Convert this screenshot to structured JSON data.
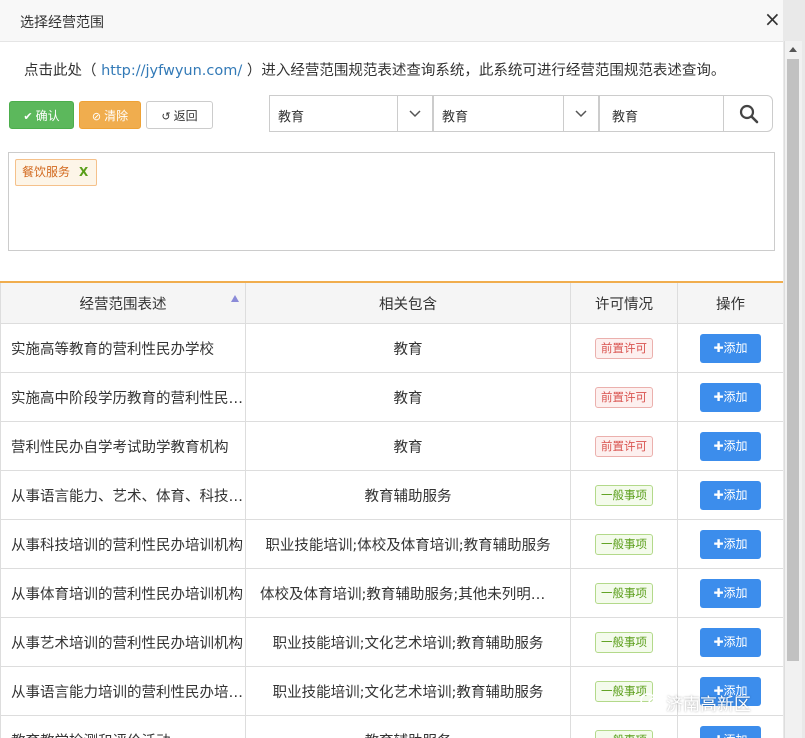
{
  "dialog": {
    "title": "选择经营范围",
    "close": "×"
  },
  "info": {
    "prefix": "点击此处（ ",
    "link": "http://jyfwyun.com/",
    "suffix": " ）进入经营范围规范表述查询系统，此系统可进行经营范围规范表述查询。"
  },
  "toolbar": {
    "confirm": "确认",
    "clear": "清除",
    "back": "返回"
  },
  "filters": {
    "select1": "教育",
    "select2": "教育",
    "search_value": "教育"
  },
  "selected_tags": [
    {
      "label": "餐饮服务",
      "remove": "X"
    }
  ],
  "table": {
    "headers": [
      "经营范围表述",
      "相关包含",
      "许可情况",
      "操作"
    ],
    "add_label": "添加",
    "rows": [
      {
        "desc": "实施高等教育的营利性民办学校",
        "related": "教育",
        "permit": "前置许可"
      },
      {
        "desc": "实施高中阶段学历教育的营利性民办学校",
        "related": "教育",
        "permit": "前置许可"
      },
      {
        "desc": "营利性民办自学考试助学教育机构",
        "related": "教育",
        "permit": "前置许可"
      },
      {
        "desc": "从事语言能力、艺术、体育、科技培训",
        "related": "教育辅助服务",
        "permit": "一般事项"
      },
      {
        "desc": "从事科技培训的营利性民办培训机构",
        "related": "职业技能培训;体校及体育培训;教育辅助服务",
        "permit": "一般事项"
      },
      {
        "desc": "从事体育培训的营利性民办培训机构",
        "related": "体校及体育培训;教育辅助服务;其他未列明教育",
        "permit": "一般事项"
      },
      {
        "desc": "从事艺术培训的营利性民办培训机构",
        "related": "职业技能培训;文化艺术培训;教育辅助服务",
        "permit": "一般事项"
      },
      {
        "desc": "从事语言能力培训的营利性民办培训机构",
        "related": "职业技能培训;文化艺术培训;教育辅助服务",
        "permit": "一般事项"
      },
      {
        "desc": "教育教学检测和评价活动",
        "related": "教育辅助服务",
        "permit": "一般事项"
      }
    ]
  },
  "watermark": "济南高新区",
  "colors": {
    "confirm": "#5cb85c",
    "clear": "#f0ad4e",
    "add": "#3c8dec",
    "permit_required": "#d9534f",
    "permit_general": "#5a9e1a"
  }
}
